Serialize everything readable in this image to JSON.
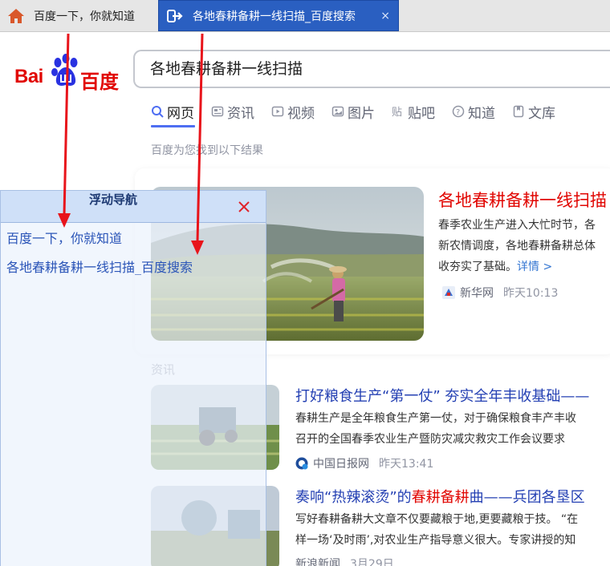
{
  "tabs": [
    {
      "title": "百度一下，你就知道",
      "icon": "home-icon"
    },
    {
      "title": "各地春耕备耕一线扫描_百度搜索",
      "icon": "tab-switch-icon",
      "close": "×"
    }
  ],
  "header": {
    "logo": {
      "part1": "Bai",
      "part2": "百度"
    },
    "search_value": "各地春耕备耕一线扫描"
  },
  "nav_tabs": [
    {
      "label": "网页",
      "icon": "search-icon"
    },
    {
      "label": "资讯",
      "icon": "news-icon"
    },
    {
      "label": "视频",
      "icon": "video-icon"
    },
    {
      "label": "图片",
      "icon": "image-icon"
    },
    {
      "label": "贴吧",
      "icon": "tieba-icon"
    },
    {
      "label": "知道",
      "icon": "zhidao-icon"
    },
    {
      "label": "文库",
      "icon": "wenku-icon"
    }
  ],
  "result_hint": "百度为您找到以下结果",
  "results": [
    {
      "title": "各地春耕备耕一线扫描",
      "body_lines": [
        "春季农业生产进入大忙时节，各",
        "新农情调度，各地春耕备耕总体",
        "收夯实了基础。"
      ],
      "more": "详情 >",
      "source": "新华网",
      "time": "昨天10:13"
    },
    {
      "title": "打好粮食生产“第一仗” 夯实全年丰收基础——",
      "body_lines": [
        "春耕生产是全年粮食生产第一仗，对于确保粮食丰产丰收",
        "召开的全国春季农业生产暨防灾减灾救灾工作会议要求"
      ],
      "source": "中国日报网",
      "time": "昨天13:41"
    },
    {
      "title_pre": "奏响“热辣滚烫”的",
      "title_hl": "春耕备耕",
      "title_post": "曲——兵团各垦区",
      "body_lines": [
        "写好春耕备耕大文章不仅要藏粮于地,更要藏粮于技。 “在",
        "样一场‘及时雨’,对农业生产指导意义很大。专家讲授的知"
      ],
      "source": "新浪新闻",
      "time": "3月29日"
    }
  ],
  "section_label": "资讯",
  "float_nav": {
    "title": "浮动导航",
    "links": [
      "百度一下，你就知道",
      "各地春耕备耕一线扫描_百度搜索"
    ]
  },
  "colors": {
    "brand_red": "#e10602",
    "brand_blue": "#2932e1",
    "link_blue": "#2440b3",
    "active_tab": "#2a5fc1",
    "annotation_arrow": "#e8141b"
  }
}
